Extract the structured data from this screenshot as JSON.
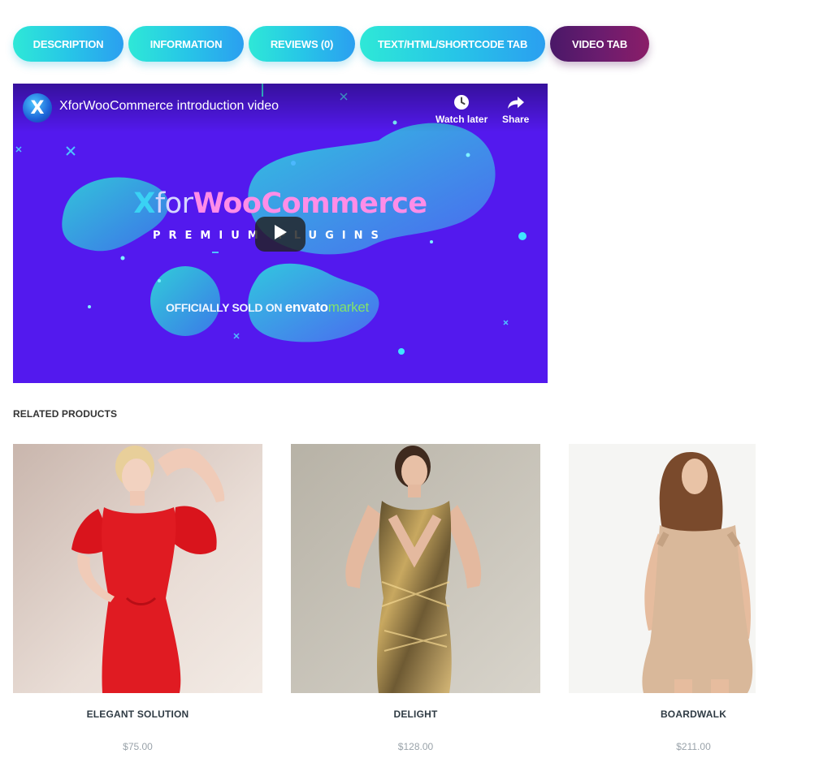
{
  "tabs": [
    {
      "label": "DESCRIPTION"
    },
    {
      "label": "INFORMATION"
    },
    {
      "label": "REVIEWS (0)"
    },
    {
      "label": "TEXT/HTML/SHORTCODE TAB"
    },
    {
      "label": "VIDEO TAB",
      "active": true
    }
  ],
  "video": {
    "title": "XforWooCommerce introduction video",
    "channel_avatar_letter": "X",
    "watch_later_label": "Watch later",
    "share_label": "Share",
    "brand_x": "X",
    "brand_for": "for",
    "brand_woo": "WooCommerce",
    "premium_text": "PREMIUM PLUGINS",
    "officially_text": "OFFICIALLY SOLD ON",
    "envato_text": "envato",
    "market_text": "market",
    "background_color": "#5319ee"
  },
  "related": {
    "heading": "RELATED PRODUCTS",
    "products": [
      {
        "name": "ELEGANT SOLUTION",
        "price": "$75.00"
      },
      {
        "name": "DELIGHT",
        "price": "$128.00"
      },
      {
        "name": "BOARDWALK",
        "price": "$211.00"
      }
    ]
  },
  "colors": {
    "tab_gradient_start": "#2ee8d7",
    "tab_gradient_end": "#2b9ff0",
    "active_tab_start": "#4a1868",
    "active_tab_end": "#8a1d68"
  }
}
